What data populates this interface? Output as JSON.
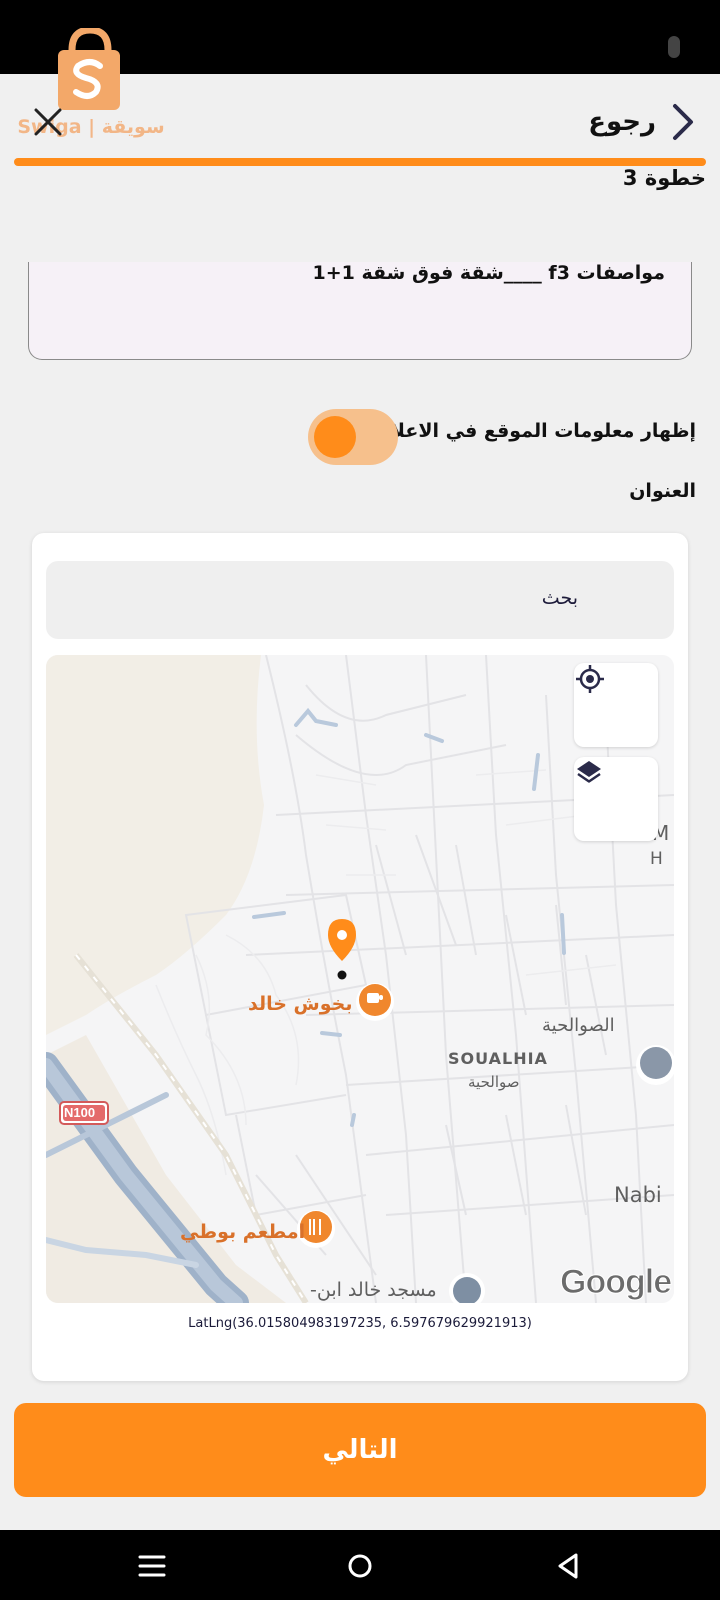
{
  "header": {
    "logo_text": "Swiga | سويقة",
    "back_label": "رجوع",
    "step_label": "خطوة 3"
  },
  "form": {
    "description_value": "مواصفات f3 ____شقة فوق شقة 1+1",
    "toggle_label": "إظهار معلومات الموقع في الاعلان",
    "toggle_on": true,
    "address_label": "العنوان",
    "search_placeholder": "بحث"
  },
  "map": {
    "poi_cafe": "بخوش خالد",
    "poi_restaurant": "امطعم بوطي",
    "area_ar": "الصوالحية",
    "area_latin": "SOUALHIA",
    "area_ar_small": "صوالحية",
    "road_badge": "N100",
    "partial_place": "Nabi",
    "partial_m": "M",
    "partial_h": "H",
    "mosque_partial": "-مسجد خالد ابن",
    "attribution": "Google"
  },
  "latlng": "LatLng(36.015804983197235, 6.597679629921913)",
  "next_button": "التالي",
  "colors": {
    "accent": "#ff8c1a",
    "toggle_track": "#f6c08c",
    "background": "#f0f0f0"
  }
}
